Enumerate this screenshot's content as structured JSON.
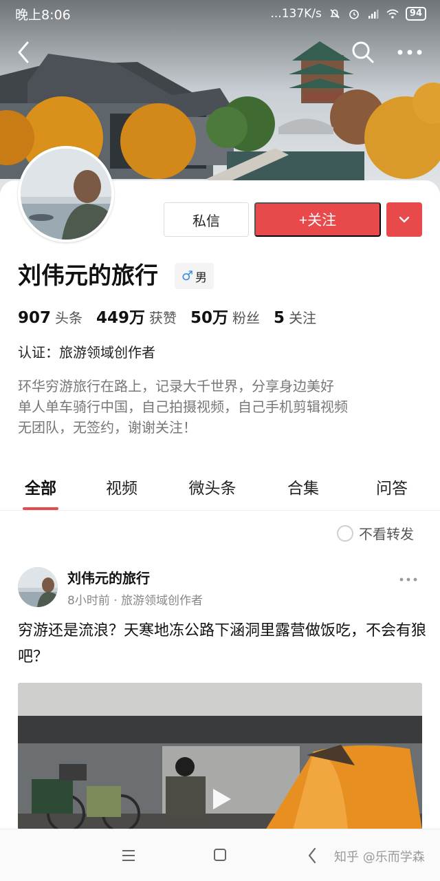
{
  "status_bar": {
    "time": "晚上8:06",
    "net_speed": "...137K/s",
    "battery": "94"
  },
  "nav": {
    "back_icon": "chevron-left-icon",
    "search_icon": "search-icon",
    "more_icon": "more-dots-icon"
  },
  "profile": {
    "name": "刘伟元的旅行",
    "gender_symbol": "♂",
    "gender_label": "男",
    "message_button": "私信",
    "follow_button": "+关注",
    "stats": [
      {
        "value": "907",
        "label": "头条"
      },
      {
        "value": "449万",
        "label": "获赞"
      },
      {
        "value": "50万",
        "label": "粉丝"
      },
      {
        "value": "5",
        "label": "关注"
      }
    ],
    "certification": "认证：旅游领域创作者",
    "bio": [
      "环华穷游旅行在路上，记录大千世界，分享身边美好",
      "单人单车骑行中国，自己拍摄视频，自己手机剪辑视频",
      "无团队，无签约，谢谢关注！"
    ]
  },
  "tabs": [
    {
      "label": "全部",
      "active": true
    },
    {
      "label": "视频",
      "active": false
    },
    {
      "label": "微头条",
      "active": false
    },
    {
      "label": "合集",
      "active": false
    },
    {
      "label": "问答",
      "active": false
    }
  ],
  "filter": {
    "label": "不看转发"
  },
  "post": {
    "author": "刘伟元的旅行",
    "meta": "8小时前 · 旅游领域创作者",
    "text": "穷游还是流浪？天寒地冻公路下涵洞里露营做饭吃，不会有狼吧？",
    "media_type": "video"
  },
  "bottom_bar": {
    "watermark": "知乎 @乐而学森"
  },
  "colors": {
    "accent": "#e84a4c",
    "gender_blue": "#3a8ee6"
  }
}
